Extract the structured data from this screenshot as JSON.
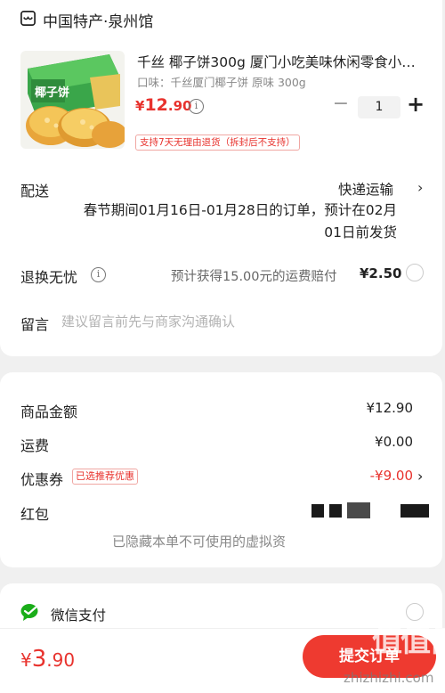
{
  "store": {
    "name": "中国特产·泉州馆",
    "icon": "store-icon"
  },
  "product": {
    "title": "千丝 椰子饼300g 厦门小吃美味休闲零食小…",
    "spec": "口味：千丝厦门椰子饼 原味 300g",
    "price_currency": "¥",
    "price_int": "12",
    "price_dec": ".90",
    "quantity": "1",
    "minus_label": "−",
    "plus_label": "+",
    "return_policy": "支持7天无理由退货（拆封后不支持）",
    "image_label": "椰子饼"
  },
  "delivery": {
    "label": "配送",
    "method": "快递运输",
    "chevron": "›",
    "note": "春节期间01月16日-01月28日的订单，预计在02月01日前发货"
  },
  "return_service": {
    "label": "退换无忧",
    "info_icon": "i",
    "description": "预计获得15.00元的运费赔付",
    "fee": "¥2.50"
  },
  "message": {
    "label": "留言",
    "placeholder": "建议留言前先与商家沟通确认",
    "value": ""
  },
  "summary": {
    "goods_label": "商品金额",
    "goods_value": "¥12.90",
    "shipping_label": "运费",
    "shipping_value": "¥0.00",
    "coupon_label": "优惠券",
    "coupon_badge": "已选推荐优惠",
    "coupon_value": "-¥9.00",
    "coupon_chevron": "›",
    "redpacket_label": "红包",
    "virtual_note": "已隐藏本单不可使用的虚拟资"
  },
  "payment": {
    "wechat_label": "微信支付",
    "total_currency": "¥",
    "total_int": "3",
    "total_dec": ".90",
    "submit_label": "提交订单"
  },
  "watermark": {
    "logo": "值值值",
    "text": "zhizhizhi.com"
  },
  "colors": {
    "accent": "#e8322d",
    "button": "#ee3a30",
    "wechat": "#1aad19"
  }
}
